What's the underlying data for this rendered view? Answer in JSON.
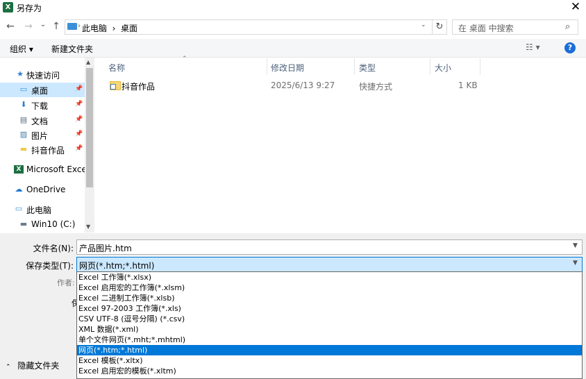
{
  "window": {
    "title": "另存为",
    "app_icon": "X"
  },
  "nav": {
    "back_icon": "←",
    "forward_icon": "→",
    "recent_icon": "⌄",
    "up_icon": "↑"
  },
  "address": {
    "path": "此电脑  ›  桌面",
    "leading_chevron": "›",
    "dropdown_icon": "⌄",
    "refresh_icon": "↻"
  },
  "search": {
    "placeholder": "在 桌面 中搜索",
    "icon": "⌕"
  },
  "toolbar": {
    "organize": "组织 ▾",
    "new_folder": "新建文件夹",
    "view_icon": "☷ ▾",
    "help": "?"
  },
  "sidebar": {
    "items": [
      {
        "label": "快速访问",
        "icon": "★"
      },
      {
        "label": "桌面",
        "icon": "▭"
      },
      {
        "label": "下载",
        "icon": "⬇"
      },
      {
        "label": "文档",
        "icon": "▤"
      },
      {
        "label": "图片",
        "icon": "▨"
      },
      {
        "label": "抖音作品",
        "icon": "▬"
      },
      {
        "label": "Microsoft Excel",
        "icon": "X"
      },
      {
        "label": "OneDrive",
        "icon": "☁"
      },
      {
        "label": "此电脑",
        "icon": "▭"
      },
      {
        "label": "Win10 (C:)",
        "icon": "▬"
      }
    ],
    "pin_icon": "📌"
  },
  "columns": {
    "name": "名称",
    "modified": "修改日期",
    "type": "类型",
    "size": "大小"
  },
  "files": [
    {
      "name": "抖音作品",
      "modified": "2025/6/13 9:27",
      "type": "快捷方式",
      "size": "1 KB"
    }
  ],
  "form": {
    "filename_label": "文件名(N):",
    "filename_value": "产品图片.htm",
    "filetype_label": "保存类型(T):",
    "filetype_value": "网页(*.htm;*.html)",
    "author_label": "作者:",
    "partial_label": "保",
    "hide_folders": "隐藏文件夹"
  },
  "filetype_options": [
    "Excel 工作簿(*.xlsx)",
    "Excel 启用宏的工作簿(*.xlsm)",
    "Excel 二进制工作簿(*.xlsb)",
    "Excel 97-2003 工作簿(*.xls)",
    "CSV UTF-8 (逗号分隔) (*.csv)",
    "XML 数据(*.xml)",
    "单个文件网页(*.mht;*.mhtml)",
    "网页(*.htm;*.html)",
    "Excel 模板(*.xltx)",
    "Excel 启用宏的模板(*.xltm)"
  ],
  "selected_option_index": 7
}
